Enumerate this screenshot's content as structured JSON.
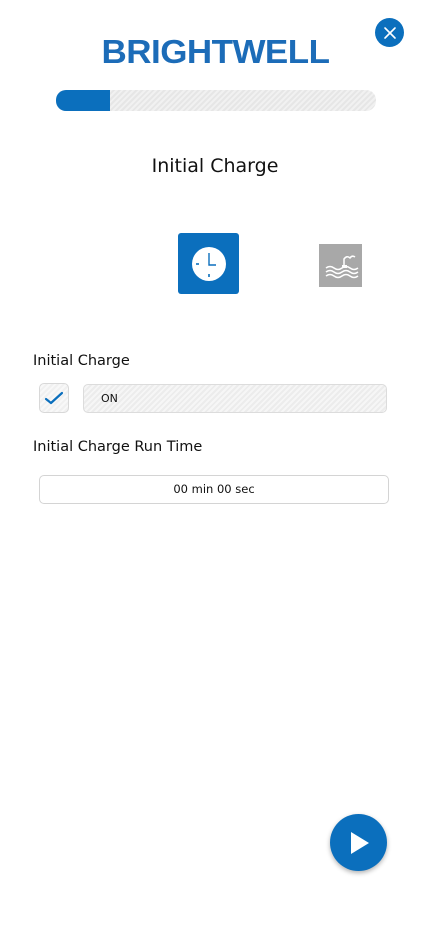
{
  "brand": {
    "logo_text": "BRIGHTWELL",
    "color": "#1c6cb8"
  },
  "header": {
    "close_icon": "close-icon"
  },
  "progress": {
    "fraction": 0.17
  },
  "step": {
    "title": "Initial Charge",
    "icons": [
      {
        "name": "clock-icon",
        "active": true
      },
      {
        "name": "water-tank-icon",
        "active": false
      }
    ]
  },
  "initial_charge": {
    "label": "Initial Charge",
    "checked": true,
    "status_value": "ON"
  },
  "run_time": {
    "label": "Initial Charge Run Time",
    "value": "00 min 00 sec"
  },
  "footer": {
    "next_icon": "play-icon"
  },
  "colors": {
    "accent": "#0b6fbd",
    "inactive_icon": "#a8a8a8"
  }
}
